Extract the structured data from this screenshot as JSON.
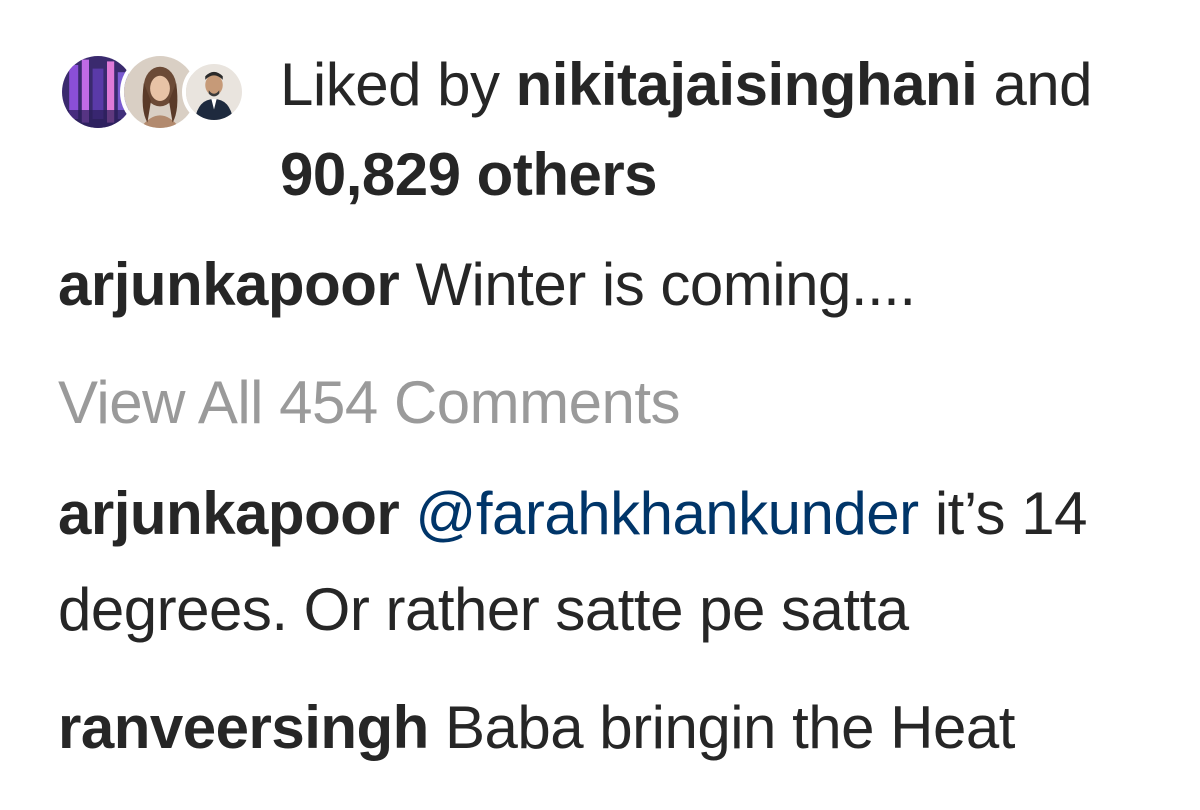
{
  "likes": {
    "prefix": "Liked by",
    "liker": "nikitajaisinghani",
    "and": "and",
    "others": "90,829 others",
    "avatars": [
      "avatar-neon-city",
      "avatar-woman-portrait",
      "avatar-man-portrait"
    ]
  },
  "caption": {
    "username": "arjunkapoor",
    "text": "Winter is coming...."
  },
  "view_all": "View All 454 Comments",
  "comments": [
    {
      "username": "arjunkapoor",
      "mention": "@farahkhankunder",
      "text_line1": "it’s 14",
      "text_line2": "degrees. Or rather satte pe satta"
    },
    {
      "username": "ranveersingh",
      "text": "Baba bringin the Heat"
    }
  ],
  "colors": {
    "text": "#262626",
    "muted": "#9a9a9a",
    "mention": "#003569"
  }
}
